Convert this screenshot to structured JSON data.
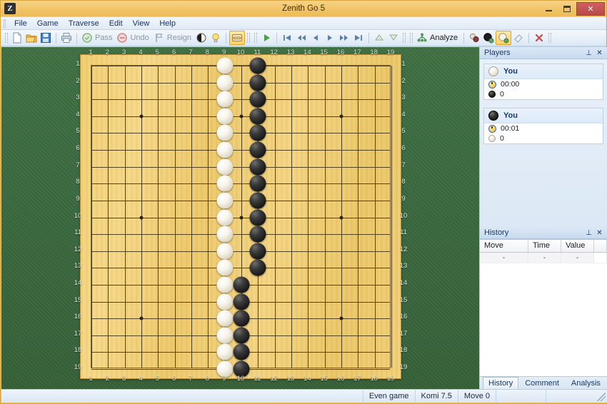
{
  "window": {
    "title": "Zenith Go 5",
    "app_icon": "Z",
    "minimize_label": "minimize",
    "maximize_label": "maximize",
    "close_label": "✕"
  },
  "menu": {
    "items": [
      {
        "label": "File"
      },
      {
        "label": "Game"
      },
      {
        "label": "Traverse"
      },
      {
        "label": "Edit"
      },
      {
        "label": "View"
      },
      {
        "label": "Help"
      }
    ]
  },
  "toolbar": {
    "new_label": "new-file",
    "open_label": "open-file",
    "save_label": "save-file",
    "print_label": "print",
    "pass_label": "Pass",
    "undo_label": "Undo",
    "resign_label": "Resign",
    "analyze_label": "Analyze",
    "nav": {
      "play": "▶",
      "first": "|◀",
      "rewind": "◀◀",
      "prev": "◀",
      "next": "▶",
      "fast_forward": "▶▶",
      "last": "▶|"
    }
  },
  "board": {
    "size": 19,
    "column_labels": [
      "1",
      "2",
      "3",
      "4",
      "5",
      "6",
      "7",
      "8",
      "9",
      "10",
      "11",
      "12",
      "13",
      "14",
      "15",
      "16",
      "17",
      "18",
      "19"
    ],
    "row_labels": [
      "1",
      "2",
      "3",
      "4",
      "5",
      "6",
      "7",
      "8",
      "9",
      "10",
      "11",
      "12",
      "13",
      "14",
      "15",
      "16",
      "17",
      "18",
      "19"
    ],
    "star_points": [
      [
        4,
        4
      ],
      [
        10,
        4
      ],
      [
        16,
        4
      ],
      [
        4,
        10
      ],
      [
        10,
        10
      ],
      [
        16,
        10
      ],
      [
        4,
        16
      ],
      [
        10,
        16
      ],
      [
        16,
        16
      ]
    ],
    "white_stones": [
      [
        9,
        1
      ],
      [
        9,
        2
      ],
      [
        9,
        3
      ],
      [
        9,
        4
      ],
      [
        9,
        5
      ],
      [
        9,
        6
      ],
      [
        9,
        7
      ],
      [
        9,
        8
      ],
      [
        9,
        9
      ],
      [
        9,
        10
      ],
      [
        9,
        11
      ],
      [
        9,
        12
      ],
      [
        9,
        13
      ],
      [
        9,
        14
      ],
      [
        9,
        15
      ],
      [
        9,
        16
      ],
      [
        9,
        17
      ],
      [
        9,
        18
      ],
      [
        9,
        19
      ]
    ],
    "black_stones": [
      [
        11,
        1
      ],
      [
        11,
        2
      ],
      [
        11,
        3
      ],
      [
        11,
        4
      ],
      [
        11,
        5
      ],
      [
        11,
        6
      ],
      [
        11,
        7
      ],
      [
        11,
        8
      ],
      [
        11,
        9
      ],
      [
        11,
        10
      ],
      [
        11,
        11
      ],
      [
        11,
        12
      ],
      [
        11,
        13
      ],
      [
        10,
        14
      ],
      [
        10,
        15
      ],
      [
        10,
        16
      ],
      [
        10,
        17
      ],
      [
        10,
        18
      ],
      [
        10,
        19
      ]
    ]
  },
  "players": {
    "panel_title": "Players",
    "pin_label": "⊥",
    "close_label": "✕",
    "list": [
      {
        "color": "white",
        "name": "You",
        "time": "00:00",
        "captures": "0",
        "capture_color": "black"
      },
      {
        "color": "black",
        "name": "You",
        "time": "00:01",
        "captures": "0",
        "capture_color": "white"
      }
    ]
  },
  "history": {
    "panel_title": "History",
    "pin_label": "⊥",
    "close_label": "✕",
    "columns": [
      "Move",
      "Time",
      "Value"
    ],
    "rows": [
      [
        "-",
        "-",
        "-"
      ]
    ],
    "tabs": [
      {
        "label": "History",
        "active": true
      },
      {
        "label": "Comment",
        "active": false
      },
      {
        "label": "Analysis",
        "active": false
      }
    ]
  },
  "status": {
    "game_type": "Even game",
    "komi": "Komi 7.5",
    "move": "Move 0"
  },
  "colors": {
    "title_bar": "#f2c468",
    "board_wood": "#f0cf72",
    "felt_green": "#3f7043",
    "accent_blue": "#17365d",
    "close_red": "#b94a4a"
  }
}
